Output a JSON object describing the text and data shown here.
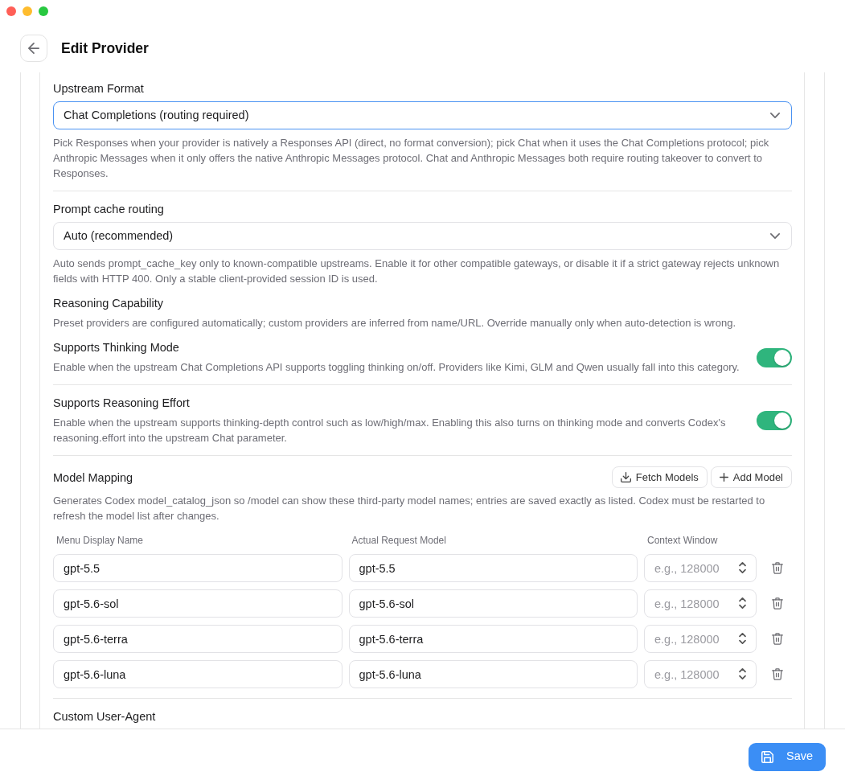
{
  "window": {
    "title": "Edit Provider"
  },
  "sections": [
    {
      "items": [
        {
          "kind": "select",
          "label": "Upstream Format",
          "value": "Chat Completions (routing required)",
          "focused": true,
          "help": "Pick Responses when your provider is natively a Responses API (direct, no format conversion); pick Chat when it uses the Chat Completions protocol; pick Anthropic Messages when it only offers the native Anthropic Messages protocol. Chat and Anthropic Messages both require routing takeover to convert to Responses."
        }
      ]
    },
    {
      "items": [
        {
          "kind": "select",
          "label": "Prompt cache routing",
          "value": "Auto (recommended)",
          "focused": false,
          "help": "Auto sends prompt_cache_key only to known-compatible upstreams. Enable it for other compatible gateways, or disable it if a strict gateway rejects unknown fields with HTTP 400. Only a stable client-provided session ID is used."
        },
        {
          "kind": "text",
          "label": "Reasoning Capability",
          "help": "Preset providers are configured automatically; custom providers are inferred from name/URL. Override manually only when auto-detection is wrong."
        },
        {
          "kind": "toggle",
          "label": "Supports Thinking Mode",
          "help": "Enable when the upstream Chat Completions API supports toggling thinking on/off. Providers like Kimi, GLM and Qwen usually fall into this category.",
          "on": true
        }
      ]
    },
    {
      "items": [
        {
          "kind": "toggle",
          "label": "Supports Reasoning Effort",
          "help": "Enable when the upstream supports thinking-depth control such as low/high/max. Enabling this also turns on thinking mode and converts Codex's reasoning.effort into the upstream Chat parameter.",
          "on": true
        }
      ]
    },
    {
      "items": [
        {
          "kind": "models",
          "label": "Model Mapping",
          "actions": [
            "Fetch Models",
            "Add Model"
          ],
          "help": "Generates Codex model_catalog_json so /model can show these third-party model names; entries are saved exactly as listed. Codex must be restarted to refresh the model list after changes.",
          "columns": [
            "Menu Display Name",
            "Actual Request Model",
            "Context Window"
          ],
          "rows": [
            {
              "display_name": "gpt-5.5",
              "request_model": "gpt-5.5",
              "context_window_placeholder": "e.g., 128000"
            },
            {
              "display_name": "gpt-5.6-sol",
              "request_model": "gpt-5.6-sol",
              "context_window_placeholder": "e.g., 128000"
            },
            {
              "display_name": "gpt-5.6-terra",
              "request_model": "gpt-5.6-terra",
              "context_window_placeholder": "e.g., 128000"
            },
            {
              "display_name": "gpt-5.6-luna",
              "request_model": "gpt-5.6-luna",
              "context_window_placeholder": "e.g., 128000"
            }
          ]
        }
      ]
    },
    {
      "items": [
        {
          "kind": "text",
          "label": "Custom User-Agent"
        }
      ]
    }
  ],
  "footer": {
    "save_button": "Save"
  }
}
